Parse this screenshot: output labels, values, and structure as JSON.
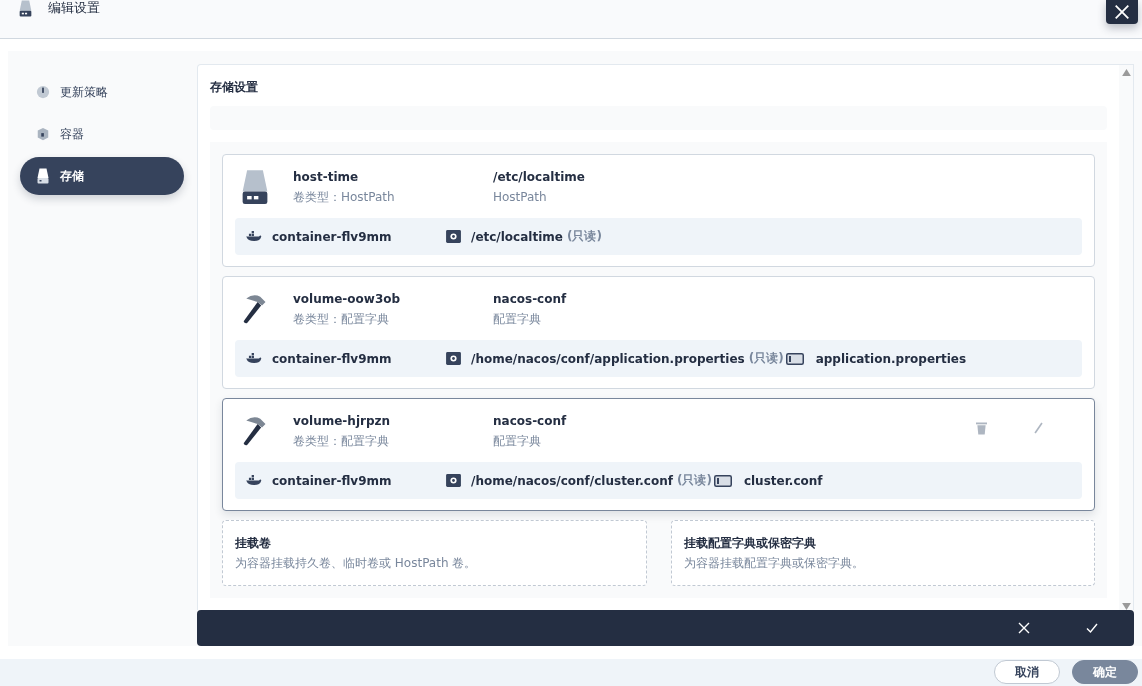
{
  "header": {
    "title": "编辑设置"
  },
  "nav": [
    {
      "label": "更新策略",
      "kind": "gauge",
      "selected": false
    },
    {
      "label": "容器",
      "kind": "cube",
      "selected": false
    },
    {
      "label": "存储",
      "kind": "disk",
      "selected": true
    }
  ],
  "section_title": "存储设置",
  "volumes": [
    {
      "kind": "hostpath",
      "name": "host-time",
      "type_label": "卷类型：HostPath",
      "source": "/etc/localtime",
      "source_type": "HostPath",
      "selected": false,
      "mounts": [
        {
          "container": "container-flv9mm",
          "path": "/etc/localtime",
          "mode": "(只读)"
        }
      ]
    },
    {
      "kind": "configmap",
      "name": "volume-oow3ob",
      "type_label": "卷类型：配置字典",
      "source": "nacos-conf",
      "source_type": "配置字典",
      "selected": false,
      "mounts": [
        {
          "container": "container-flv9mm",
          "path": "/home/nacos/conf/application.properties",
          "mode": "(只读)",
          "sub_path": "application.properties"
        }
      ]
    },
    {
      "kind": "configmap",
      "name": "volume-hjrpzn",
      "type_label": "卷类型：配置字典",
      "source": "nacos-conf",
      "source_type": "配置字典",
      "selected": true,
      "mounts": [
        {
          "container": "container-flv9mm",
          "path": "/home/nacos/conf/cluster.conf",
          "mode": "(只读)",
          "sub_path": "cluster.conf"
        }
      ]
    }
  ],
  "add_options": [
    {
      "title": "挂载卷",
      "description": "为容器挂载持久卷、临时卷或 HostPath 卷。"
    },
    {
      "title": "挂载配置字典或保密字典",
      "description": "为容器挂载配置字典或保密字典。"
    }
  ],
  "footer_buttons": [
    {
      "label": "取消",
      "kind": "secondary"
    },
    {
      "label": "确定",
      "kind": "primary"
    }
  ]
}
